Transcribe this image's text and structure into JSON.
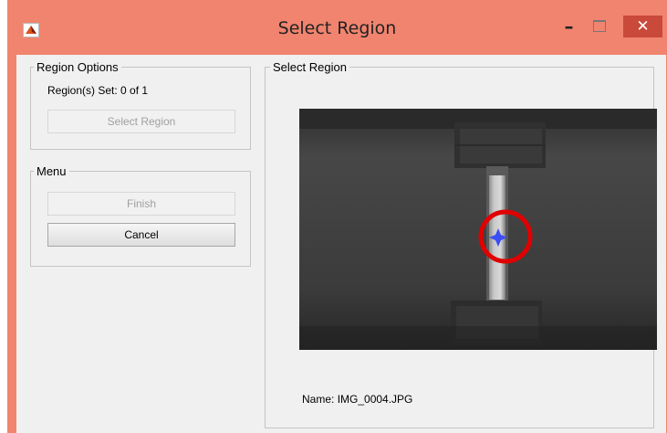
{
  "window": {
    "title": "Select Region",
    "controls": {
      "minimize": "–",
      "close": "✕"
    }
  },
  "region_options": {
    "legend": "Region Options",
    "status": "Region(s) Set: 0 of 1",
    "select_button": "Select Region"
  },
  "menu": {
    "legend": "Menu",
    "finish_button": "Finish",
    "cancel_button": "Cancel"
  },
  "select_region": {
    "legend": "Select Region",
    "name_label": "Name:",
    "file_name": "IMG_0004.JPG"
  },
  "colors": {
    "titlebar": "#f1846f",
    "close_button": "#c9493b",
    "highlight_circle": "#e00000",
    "marker": "#3b4ef5"
  }
}
